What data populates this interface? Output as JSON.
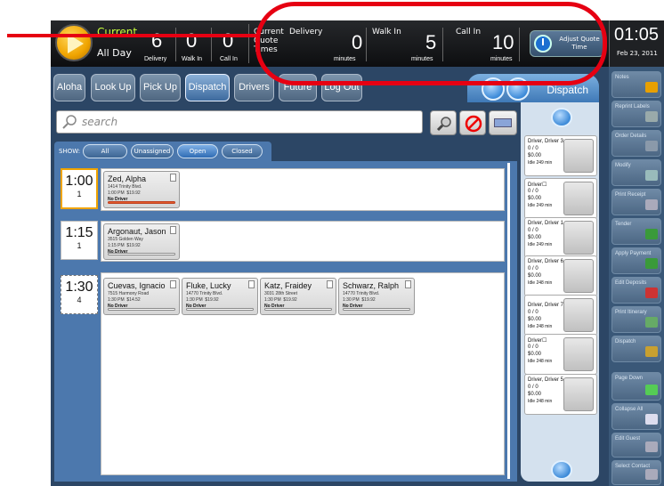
{
  "topbar": {
    "current_label": "Current",
    "all_day_label": "All Day",
    "counts": [
      {
        "value": "6",
        "label": "Delivery"
      },
      {
        "value": "0",
        "label": "Walk In"
      },
      {
        "value": "0",
        "label": "Call In"
      }
    ],
    "quote_times_label": "Current Quote Times",
    "quotes": [
      {
        "label": "Delivery",
        "value": "0",
        "unit": "minutes"
      },
      {
        "label": "Walk In",
        "value": "5",
        "unit": "minutes"
      },
      {
        "label": "Call In",
        "value": "10",
        "unit": "minutes"
      }
    ],
    "adjust_quote_label": "Adjust Quote Time",
    "time": "01:05",
    "date": "Feb 23, 2011"
  },
  "nav": [
    "Aloha",
    "Look Up",
    "Pick Up",
    "Dispatch",
    "Drivers",
    "Future",
    "Log Out"
  ],
  "nav_active": "Dispatch",
  "dispatch_tab": "Dispatch",
  "search": {
    "placeholder": "search"
  },
  "show": {
    "label": "SHOW:",
    "filters": [
      "All",
      "Unassigned",
      "Open",
      "Closed"
    ],
    "active": "Open"
  },
  "time_rows": [
    {
      "time": "1:00",
      "count": "1"
    },
    {
      "time": "1:15",
      "count": "1"
    },
    {
      "time": "1:30",
      "count": "4"
    }
  ],
  "orders": [
    {
      "name": "Zed, Alpha",
      "address": "1414 Trinity Blvd.",
      "time": "1:00 PM",
      "amount": "$19.92",
      "driver": "No Driver"
    },
    {
      "name": "Argonaut, Jason",
      "address": "3515 Golden Way",
      "time": "1:15 PM",
      "amount": "$19.92",
      "driver": "No Driver"
    },
    {
      "name": "Cuevas, Ignacio",
      "address": "7515 Harmony Road",
      "time": "1:30 PM",
      "amount": "$14.52",
      "driver": "No Driver"
    },
    {
      "name": "Fluke, Lucky",
      "address": "14770 Trinity Blvd.",
      "time": "1:30 PM",
      "amount": "$19.92",
      "driver": "No Driver"
    },
    {
      "name": "Katz, Fraidey",
      "address": "3031 28th Street",
      "time": "1:30 PM",
      "amount": "$19.92",
      "driver": "No Driver"
    },
    {
      "name": "Schwarz, Ralph",
      "address": "14770 Trinity Blvd.",
      "time": "1:30 PM",
      "amount": "$19.92",
      "driver": "No Driver"
    }
  ],
  "drivers": [
    {
      "name": "Driver, Driver 3",
      "orders": "0 / 0",
      "amount": "$0.00",
      "idle": "Idle 249 min"
    },
    {
      "name": "Driver☐",
      "orders": "0 / 0",
      "amount": "$0.00",
      "idle": "Idle 249 min"
    },
    {
      "name": "Driver, Driver 1",
      "orders": "0 / 0",
      "amount": "$0.00",
      "idle": "Idle 249 min"
    },
    {
      "name": "Driver, Driver 6",
      "orders": "0 / 0",
      "amount": "$0.00",
      "idle": "Idle 248 min"
    },
    {
      "name": "Driver, Driver 7",
      "orders": "0 / 0",
      "amount": "$0.00",
      "idle": "Idle 248 min"
    },
    {
      "name": "Driver☐",
      "orders": "0 / 0",
      "amount": "$0.00",
      "idle": "Idle 248 min"
    },
    {
      "name": "Driver, Driver 5",
      "orders": "0 / 0",
      "amount": "$0.00",
      "idle": "Idle 248 min"
    }
  ],
  "right_buttons": [
    "Notes",
    "Reprint Labels",
    "Order Details",
    "Modify",
    "Print Receipt",
    "Tender",
    "Apply Payment",
    "Edit Deposits",
    "Print Itinerary",
    "Dispatch"
  ],
  "right_bottom": [
    "Page Down",
    "Collapse All",
    "Edit Guest",
    "Select Contact"
  ],
  "colors": {
    "accent": "#c8ff3a",
    "annotation": "#e60012",
    "panel": "#4c78ad"
  }
}
